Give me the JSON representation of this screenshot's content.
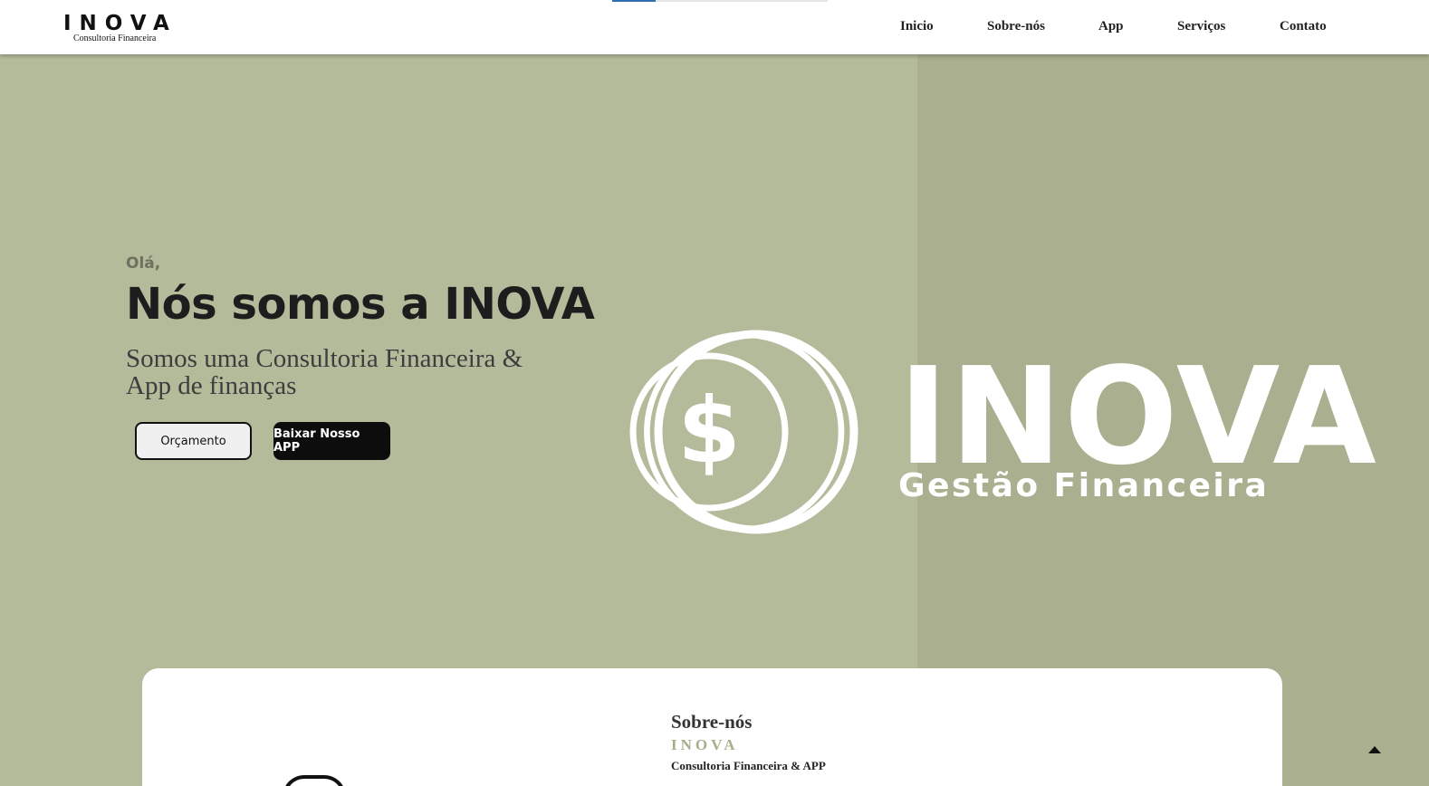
{
  "header": {
    "brand_name": "INOVA",
    "brand_tagline": "Consultoria Financeira",
    "scroll_progress": 0.2,
    "nav": [
      {
        "label": "Inicio"
      },
      {
        "label": "Sobre-nós"
      },
      {
        "label": "App"
      },
      {
        "label": "Serviços"
      },
      {
        "label": "Contato"
      }
    ]
  },
  "hero": {
    "greeting": "Olá,",
    "headline": "Nós somos a INOVA",
    "subline": "Somos uma Consultoria Financeira & App de finanças",
    "buttons": {
      "quote": "Orçamento",
      "download_app": "Baixar Nosso APP"
    },
    "logo": {
      "word": "INOVA",
      "tagline": "Gestão Financeira",
      "icon": "coins-dollar-icon"
    }
  },
  "about": {
    "title": "Sobre-nós",
    "brand": "INOVA",
    "subtitle": "Consultoria Financeira & APP"
  },
  "colors": {
    "hero_bg": "#b4bb9b",
    "hero_bg_right": "#aaaf8f",
    "accent": "#a8ad8a",
    "progress": "#2f6fb3"
  }
}
